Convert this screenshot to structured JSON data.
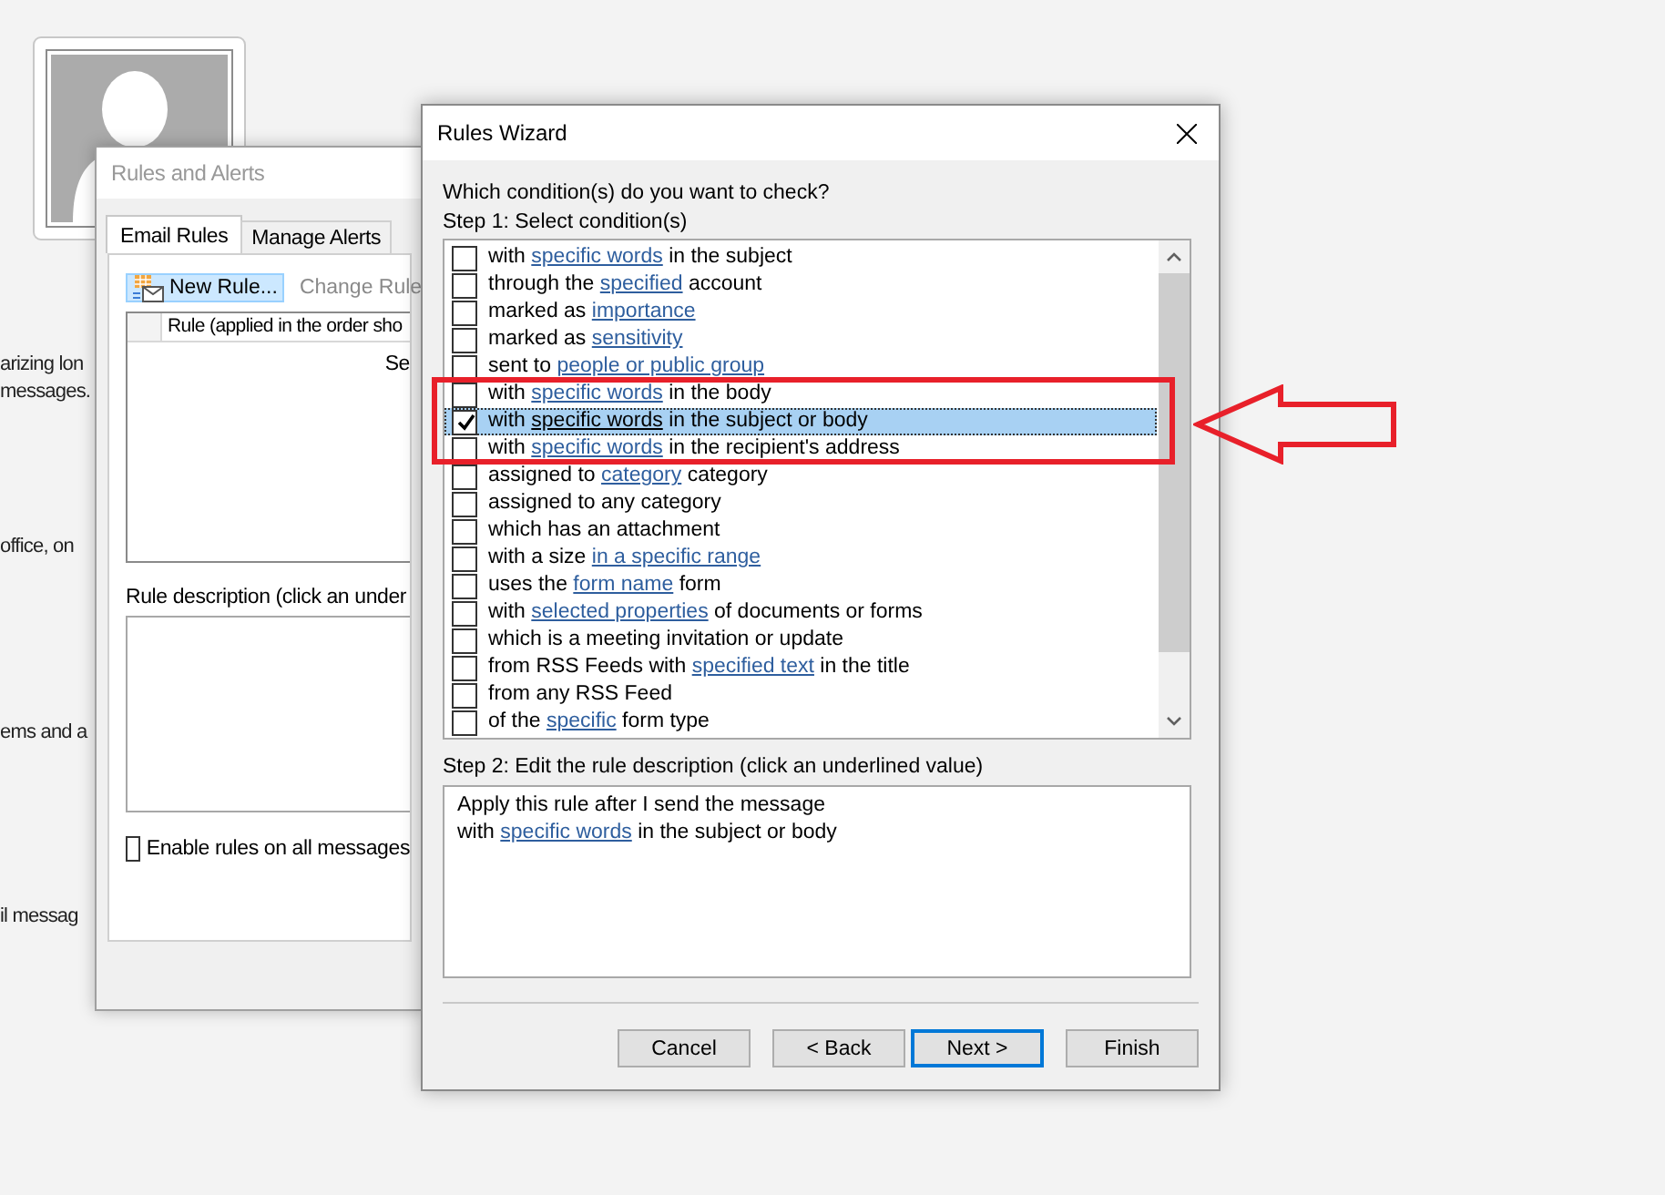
{
  "background": {
    "texts": [
      "arizing lon",
      "messages.",
      "office, on",
      "ems and a",
      "il messag"
    ]
  },
  "rules_and_alerts": {
    "title": "Rules and Alerts",
    "active": false,
    "tabs": [
      {
        "label": "Email Rules",
        "selected": true
      },
      {
        "label": "Manage Alerts",
        "selected": false
      }
    ],
    "toolbar": [
      {
        "label": "New Rule...",
        "kind": "new",
        "highlighted": true,
        "disabled": false
      },
      {
        "label": "Change Rule",
        "kind": "dropdown",
        "highlighted": false,
        "disabled": true
      }
    ],
    "rule_list": {
      "header": "Rule (applied in the order sho",
      "cell": "Se"
    },
    "description_label": "Rule description (click an under",
    "enable_checkbox": {
      "label": "Enable rules on all messages",
      "checked": false
    }
  },
  "rules_wizard": {
    "title": "Rules Wizard",
    "active": true,
    "question": "Which condition(s) do you want to check?",
    "step1_label": "Step 1: Select condition(s)",
    "conditions": [
      {
        "parts": [
          {
            "text": "with ",
            "kind": "plain"
          },
          {
            "text": "specific words",
            "kind": "link"
          },
          {
            "text": " in the subject",
            "kind": "plain"
          }
        ],
        "checked": false,
        "selected": false
      },
      {
        "parts": [
          {
            "text": "through the ",
            "kind": "plain"
          },
          {
            "text": "specified",
            "kind": "link"
          },
          {
            "text": " account",
            "kind": "plain"
          }
        ],
        "checked": false,
        "selected": false
      },
      {
        "parts": [
          {
            "text": "marked as ",
            "kind": "plain"
          },
          {
            "text": "importance",
            "kind": "link"
          }
        ],
        "checked": false,
        "selected": false
      },
      {
        "parts": [
          {
            "text": "marked as ",
            "kind": "plain"
          },
          {
            "text": "sensitivity",
            "kind": "link"
          }
        ],
        "checked": false,
        "selected": false
      },
      {
        "parts": [
          {
            "text": "sent to ",
            "kind": "plain"
          },
          {
            "text": "people or public group",
            "kind": "link"
          }
        ],
        "checked": false,
        "selected": false
      },
      {
        "parts": [
          {
            "text": "with ",
            "kind": "plain"
          },
          {
            "text": "specific words",
            "kind": "link"
          },
          {
            "text": " in the body",
            "kind": "plain"
          }
        ],
        "checked": false,
        "selected": false
      },
      {
        "parts": [
          {
            "text": "with ",
            "kind": "plain"
          },
          {
            "text": "specific words",
            "kind": "link"
          },
          {
            "text": " in the subject or body",
            "kind": "plain"
          }
        ],
        "checked": true,
        "selected": true
      },
      {
        "parts": [
          {
            "text": "with ",
            "kind": "plain"
          },
          {
            "text": "specific words",
            "kind": "link"
          },
          {
            "text": " in the recipient's address",
            "kind": "plain"
          }
        ],
        "checked": false,
        "selected": false
      },
      {
        "parts": [
          {
            "text": "assigned to ",
            "kind": "plain"
          },
          {
            "text": "category",
            "kind": "link"
          },
          {
            "text": " category",
            "kind": "plain"
          }
        ],
        "checked": false,
        "selected": false
      },
      {
        "parts": [
          {
            "text": "assigned to any category",
            "kind": "plain"
          }
        ],
        "checked": false,
        "selected": false
      },
      {
        "parts": [
          {
            "text": "which has an attachment",
            "kind": "plain"
          }
        ],
        "checked": false,
        "selected": false
      },
      {
        "parts": [
          {
            "text": "with a size ",
            "kind": "plain"
          },
          {
            "text": "in a specific range",
            "kind": "link"
          }
        ],
        "checked": false,
        "selected": false
      },
      {
        "parts": [
          {
            "text": "uses the ",
            "kind": "plain"
          },
          {
            "text": "form name",
            "kind": "link"
          },
          {
            "text": " form",
            "kind": "plain"
          }
        ],
        "checked": false,
        "selected": false
      },
      {
        "parts": [
          {
            "text": "with ",
            "kind": "plain"
          },
          {
            "text": "selected properties",
            "kind": "link"
          },
          {
            "text": " of documents or forms",
            "kind": "plain"
          }
        ],
        "checked": false,
        "selected": false
      },
      {
        "parts": [
          {
            "text": "which is a meeting invitation or update",
            "kind": "plain"
          }
        ],
        "checked": false,
        "selected": false
      },
      {
        "parts": [
          {
            "text": "from RSS Feeds with ",
            "kind": "plain"
          },
          {
            "text": "specified text",
            "kind": "link"
          },
          {
            "text": " in the title",
            "kind": "plain"
          }
        ],
        "checked": false,
        "selected": false
      },
      {
        "parts": [
          {
            "text": "from any RSS Feed",
            "kind": "plain"
          }
        ],
        "checked": false,
        "selected": false
      },
      {
        "parts": [
          {
            "text": "of the ",
            "kind": "plain"
          },
          {
            "text": "specific",
            "kind": "link"
          },
          {
            "text": " form type",
            "kind": "plain"
          }
        ],
        "checked": false,
        "selected": false
      }
    ],
    "step2_label": "Step 2: Edit the rule description (click an underlined value)",
    "description": [
      {
        "parts": [
          {
            "text": "Apply this rule after I send the message",
            "kind": "plain"
          }
        ]
      },
      {
        "parts": [
          {
            "text": "with ",
            "kind": "plain"
          },
          {
            "text": "specific words",
            "kind": "link"
          },
          {
            "text": " in the subject or body",
            "kind": "plain"
          }
        ]
      }
    ],
    "buttons": [
      {
        "label": "Cancel",
        "focused": false
      },
      {
        "label": "< Back",
        "focused": false
      },
      {
        "label": "Next >",
        "focused": true
      },
      {
        "label": "Finish",
        "focused": false
      }
    ]
  },
  "annotation": {
    "kind": "frame_arrow"
  }
}
